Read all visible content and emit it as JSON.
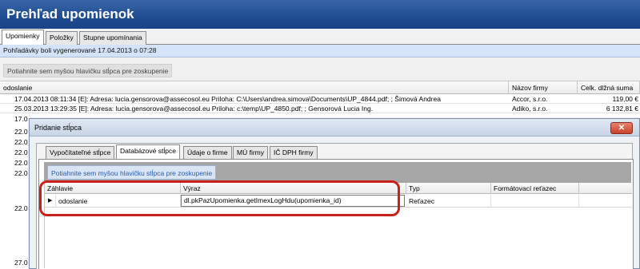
{
  "app": {
    "title": "Prehľad upomienok"
  },
  "tabs": [
    {
      "label": "Upomienky",
      "active": true
    },
    {
      "label": "Položky",
      "active": false
    },
    {
      "label": "Stupne upomínania",
      "active": false
    }
  ],
  "info": {
    "text": "Pohľadávky boli vygenerované 17.04.2013 o 07:28"
  },
  "group_hint": "Potiahnite sem myšou hlavičku stĺpca pre zoskupenie",
  "grid": {
    "columns": [
      "odoslanie",
      "Názov firmy",
      "Celk. dlžná suma"
    ],
    "rows": [
      {
        "odoslanie": "17.04.2013 08:11:34 [E]: Adresa: lucia.gensorova@assecosol.eu Priloha: C:\\Users\\andrea.simova\\Documents\\UP_4844.pdf; ; Šimová Andrea",
        "firma": "Accor, s.r.o.",
        "suma": "119,00 €"
      },
      {
        "odoslanie": "25.03.2013 13:29:35 [E]: Adresa: lucia.gensorova@assecosol.eu Priloha: c:\\temp\\UP_4850.pdf; ; Gensorová Lucia Ing.",
        "firma": "Adiko, s.r.o.",
        "suma": "6 132,81 €"
      }
    ],
    "partial_rows": [
      "17.0",
      "22.0",
      "22.0",
      "22.0",
      "22.0",
      "22.0",
      "22.0",
      "27.0"
    ]
  },
  "dialog": {
    "title": "Pridanie stĺpca",
    "close": "✕",
    "tabs": [
      {
        "label": "Vypočítateľné stĺpce",
        "active": false
      },
      {
        "label": "Databázové stĺpce",
        "active": true
      },
      {
        "label": "Údaje o firme",
        "active": false
      },
      {
        "label": "MÚ firmy",
        "active": false
      },
      {
        "label": "IČ DPH firmy",
        "active": false
      }
    ],
    "group_hint": "Potiahnite sem myšou hlavičku stĺpca pre zoskupenie",
    "columns": [
      "Záhlavie",
      "Výraz",
      "Typ",
      "Formátovací reťazec"
    ],
    "row": {
      "indicator": "▶",
      "zahlavie": "odoslanie",
      "vyraz": "dl.pkPazUpomienka.getImexLogHdu(upomienka_id)",
      "typ": "Reťazec",
      "format": ""
    }
  }
}
